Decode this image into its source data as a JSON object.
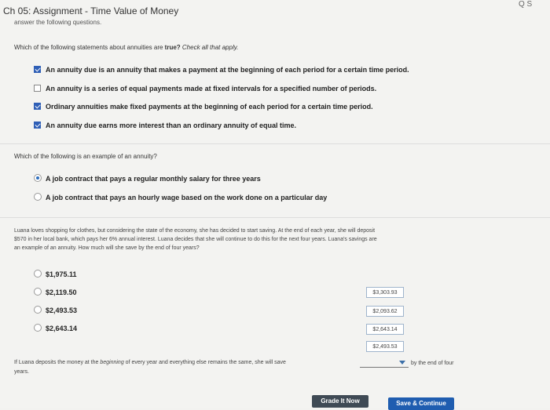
{
  "header": {
    "title": "Ch 05: Assignment - Time Value of Money",
    "subtitle": "answer the following questions."
  },
  "q1": {
    "prompt": "Which of the following statements about annuities are ",
    "prompt_bold": "true?",
    "prompt_italic": "Check all that apply.",
    "options": [
      {
        "label": "An annuity due is an annuity that makes a payment at the beginning of each period for a certain time period.",
        "checked": true
      },
      {
        "label": "An annuity is a series of equal payments made at fixed intervals for a specified number of periods.",
        "checked": false
      },
      {
        "label": "Ordinary annuities make fixed payments at the beginning of each period for a certain time period.",
        "checked": true
      },
      {
        "label": "An annuity due earns more interest than an ordinary annuity of equal time.",
        "checked": true
      }
    ]
  },
  "q2": {
    "prompt": "Which of the following is an example of an annuity?",
    "options": [
      {
        "label": "A job contract that pays a regular monthly salary for three years",
        "selected": true
      },
      {
        "label": "A job contract that pays an hourly wage based on the work done on a particular day",
        "selected": false
      }
    ]
  },
  "q3": {
    "para1": "Luana loves shopping for clothes, but considering the state of the economy, she has decided to start saving. At the end of each year, she will deposit",
    "para2": "$570 in her local bank, which pays her 6% annual interest. Luana decides that she will continue to do this for the next four years. Luana's savings are",
    "para3": "an example of an annuity. How much will she save by the end of four years?",
    "options": [
      "$1,975.11",
      "$2,119.50",
      "$2,493.53",
      "$2,643.14"
    ],
    "answer_boxes": [
      "$3,303.93",
      "$2,093.62",
      "$2,643.14",
      "$2,493.53"
    ],
    "followup_part1": "If Luana deposits the money at the ",
    "followup_italic": "beginning",
    "followup_part2": " of every year and everything else remains the same, she will save",
    "followup_part3": "years.",
    "followup_suffix": "by the end of four"
  },
  "buttons": {
    "grade": "Grade It Now",
    "save": "Save & Continue"
  },
  "corner": "Q S"
}
